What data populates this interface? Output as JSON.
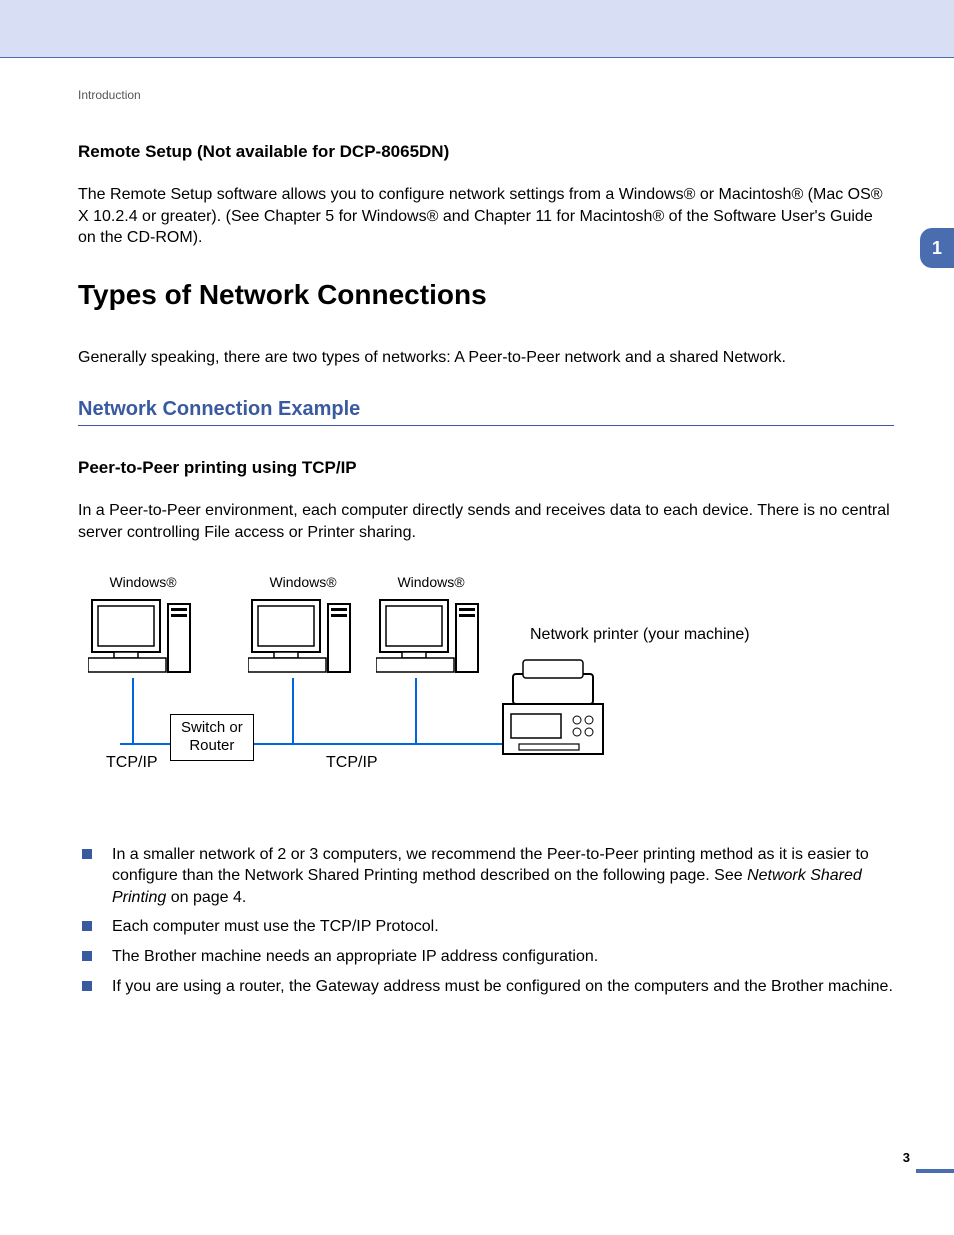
{
  "breadcrumb": "Introduction",
  "chapter_tab": "1",
  "section_remote": {
    "title": "Remote Setup (Not available for DCP-8065DN)",
    "para": "The Remote Setup software allows you to configure network settings from a Windows® or Macintosh® (Mac OS® X 10.2.4 or greater). (See Chapter 5 for Windows® and Chapter 11 for Macintosh® of the Software User's Guide on the CD-ROM)."
  },
  "h1": "Types of Network Connections",
  "para_types": "Generally speaking, there are two types of networks: A Peer-to-Peer network and a shared Network.",
  "h2": "Network Connection Example",
  "h3_p2p": "Peer-to-Peer printing using TCP/IP",
  "para_p2p": "In a Peer-to-Peer environment, each computer directly sends and receives data to each device. There is no central server controlling File access or Printer sharing.",
  "diagram": {
    "pc1": "Windows®",
    "pc2": "Windows®",
    "pc3": "Windows®",
    "switch_line1": "Switch or",
    "switch_line2": "Router",
    "tcpip": "TCP/IP",
    "printer": "Network printer (your machine)"
  },
  "bullets": [
    {
      "pre": "In a smaller network of 2 or 3 computers, we recommend the Peer-to-Peer printing method as it is easier to configure than the Network Shared Printing method described on the following page. See ",
      "link": "Network Shared Printing",
      "post": " on page 4."
    },
    {
      "pre": "Each computer must use the TCP/IP Protocol.",
      "link": "",
      "post": ""
    },
    {
      "pre": "The Brother machine needs an appropriate IP address configuration.",
      "link": "",
      "post": ""
    },
    {
      "pre": "If you are using a router, the Gateway address must be configured on the computers and the Brother machine.",
      "link": "",
      "post": ""
    }
  ],
  "page_number": "3"
}
